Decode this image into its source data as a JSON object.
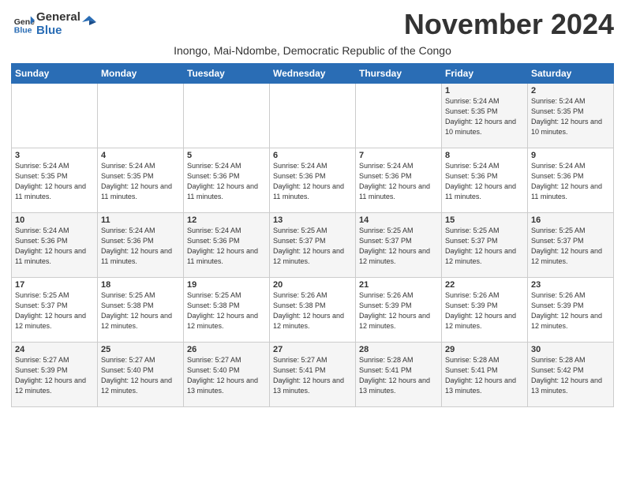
{
  "header": {
    "logo_general": "General",
    "logo_blue": "Blue",
    "month_title": "November 2024",
    "subtitle": "Inongo, Mai-Ndombe, Democratic Republic of the Congo"
  },
  "weekdays": [
    "Sunday",
    "Monday",
    "Tuesday",
    "Wednesday",
    "Thursday",
    "Friday",
    "Saturday"
  ],
  "weeks": [
    [
      {
        "day": "",
        "info": ""
      },
      {
        "day": "",
        "info": ""
      },
      {
        "day": "",
        "info": ""
      },
      {
        "day": "",
        "info": ""
      },
      {
        "day": "",
        "info": ""
      },
      {
        "day": "1",
        "info": "Sunrise: 5:24 AM\nSunset: 5:35 PM\nDaylight: 12 hours and 10 minutes."
      },
      {
        "day": "2",
        "info": "Sunrise: 5:24 AM\nSunset: 5:35 PM\nDaylight: 12 hours and 10 minutes."
      }
    ],
    [
      {
        "day": "3",
        "info": "Sunrise: 5:24 AM\nSunset: 5:35 PM\nDaylight: 12 hours and 11 minutes."
      },
      {
        "day": "4",
        "info": "Sunrise: 5:24 AM\nSunset: 5:35 PM\nDaylight: 12 hours and 11 minutes."
      },
      {
        "day": "5",
        "info": "Sunrise: 5:24 AM\nSunset: 5:36 PM\nDaylight: 12 hours and 11 minutes."
      },
      {
        "day": "6",
        "info": "Sunrise: 5:24 AM\nSunset: 5:36 PM\nDaylight: 12 hours and 11 minutes."
      },
      {
        "day": "7",
        "info": "Sunrise: 5:24 AM\nSunset: 5:36 PM\nDaylight: 12 hours and 11 minutes."
      },
      {
        "day": "8",
        "info": "Sunrise: 5:24 AM\nSunset: 5:36 PM\nDaylight: 12 hours and 11 minutes."
      },
      {
        "day": "9",
        "info": "Sunrise: 5:24 AM\nSunset: 5:36 PM\nDaylight: 12 hours and 11 minutes."
      }
    ],
    [
      {
        "day": "10",
        "info": "Sunrise: 5:24 AM\nSunset: 5:36 PM\nDaylight: 12 hours and 11 minutes."
      },
      {
        "day": "11",
        "info": "Sunrise: 5:24 AM\nSunset: 5:36 PM\nDaylight: 12 hours and 11 minutes."
      },
      {
        "day": "12",
        "info": "Sunrise: 5:24 AM\nSunset: 5:36 PM\nDaylight: 12 hours and 11 minutes."
      },
      {
        "day": "13",
        "info": "Sunrise: 5:25 AM\nSunset: 5:37 PM\nDaylight: 12 hours and 12 minutes."
      },
      {
        "day": "14",
        "info": "Sunrise: 5:25 AM\nSunset: 5:37 PM\nDaylight: 12 hours and 12 minutes."
      },
      {
        "day": "15",
        "info": "Sunrise: 5:25 AM\nSunset: 5:37 PM\nDaylight: 12 hours and 12 minutes."
      },
      {
        "day": "16",
        "info": "Sunrise: 5:25 AM\nSunset: 5:37 PM\nDaylight: 12 hours and 12 minutes."
      }
    ],
    [
      {
        "day": "17",
        "info": "Sunrise: 5:25 AM\nSunset: 5:37 PM\nDaylight: 12 hours and 12 minutes."
      },
      {
        "day": "18",
        "info": "Sunrise: 5:25 AM\nSunset: 5:38 PM\nDaylight: 12 hours and 12 minutes."
      },
      {
        "day": "19",
        "info": "Sunrise: 5:25 AM\nSunset: 5:38 PM\nDaylight: 12 hours and 12 minutes."
      },
      {
        "day": "20",
        "info": "Sunrise: 5:26 AM\nSunset: 5:38 PM\nDaylight: 12 hours and 12 minutes."
      },
      {
        "day": "21",
        "info": "Sunrise: 5:26 AM\nSunset: 5:39 PM\nDaylight: 12 hours and 12 minutes."
      },
      {
        "day": "22",
        "info": "Sunrise: 5:26 AM\nSunset: 5:39 PM\nDaylight: 12 hours and 12 minutes."
      },
      {
        "day": "23",
        "info": "Sunrise: 5:26 AM\nSunset: 5:39 PM\nDaylight: 12 hours and 12 minutes."
      }
    ],
    [
      {
        "day": "24",
        "info": "Sunrise: 5:27 AM\nSunset: 5:39 PM\nDaylight: 12 hours and 12 minutes."
      },
      {
        "day": "25",
        "info": "Sunrise: 5:27 AM\nSunset: 5:40 PM\nDaylight: 12 hours and 12 minutes."
      },
      {
        "day": "26",
        "info": "Sunrise: 5:27 AM\nSunset: 5:40 PM\nDaylight: 12 hours and 13 minutes."
      },
      {
        "day": "27",
        "info": "Sunrise: 5:27 AM\nSunset: 5:41 PM\nDaylight: 12 hours and 13 minutes."
      },
      {
        "day": "28",
        "info": "Sunrise: 5:28 AM\nSunset: 5:41 PM\nDaylight: 12 hours and 13 minutes."
      },
      {
        "day": "29",
        "info": "Sunrise: 5:28 AM\nSunset: 5:41 PM\nDaylight: 12 hours and 13 minutes."
      },
      {
        "day": "30",
        "info": "Sunrise: 5:28 AM\nSunset: 5:42 PM\nDaylight: 12 hours and 13 minutes."
      }
    ]
  ]
}
